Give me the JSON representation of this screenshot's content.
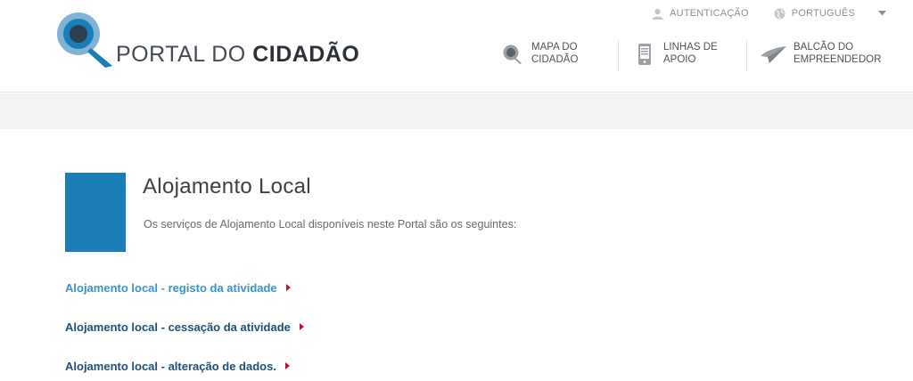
{
  "brand": {
    "name_light": "PORTAL DO ",
    "name_bold": "CIDADÃO",
    "logo_icon": "magnifier-logo-icon",
    "logo_color": "#1a7db5"
  },
  "topbar": {
    "auth_label": "AUTENTICAÇÃO",
    "auth_icon": "user-icon",
    "language_label": "PORTUGUÊS",
    "language_icon": "globe-icon",
    "dropdown_icon": "chevron-down-icon"
  },
  "quicklinks": [
    {
      "line1": "MAPA DO",
      "line2": "CIDADÃO",
      "icon": "map-search-icon"
    },
    {
      "line1": "LINHAS DE",
      "line2": "APOIO",
      "icon": "mobile-phone-icon"
    },
    {
      "line1": "BALCÃO DO",
      "line2": "EMPREENDEDOR",
      "icon": "plane-icon"
    }
  ],
  "main": {
    "title": "Alojamento Local",
    "intro": "Os serviços de Alojamento Local disponíveis neste Portal são os seguintes:",
    "accent_color": "#1a7db5",
    "links": [
      {
        "label": "Alojamento local - registo da atividade"
      },
      {
        "label": "Alojamento local - cessação da atividade"
      },
      {
        "label": "Alojamento local - alteração de dados."
      }
    ]
  }
}
